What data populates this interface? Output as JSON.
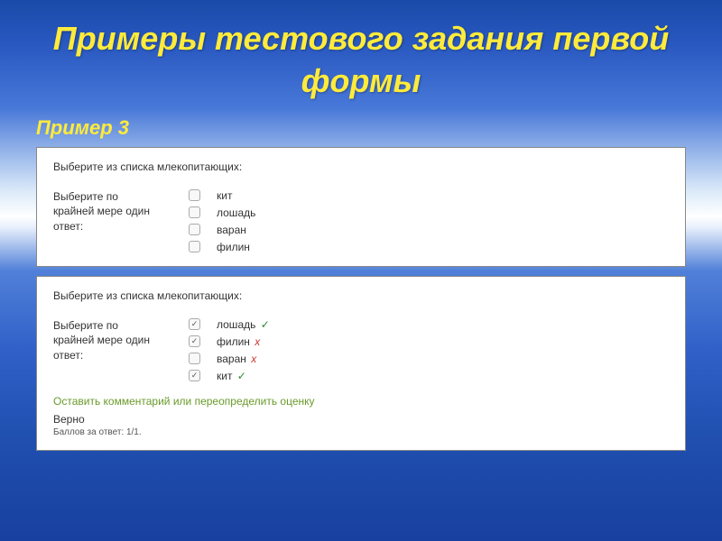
{
  "slide": {
    "title": "Примеры тестового задания первой формы",
    "example_label": "Пример 3"
  },
  "panel1": {
    "question": "Выберите из списка млекопитающих:",
    "instruction": "Выберите по крайней мере один ответ:",
    "options": [
      {
        "label": "кит",
        "checked": false
      },
      {
        "label": "лошадь",
        "checked": false
      },
      {
        "label": "варан",
        "checked": false
      },
      {
        "label": "филин",
        "checked": false
      }
    ]
  },
  "panel2": {
    "question": "Выберите из списка млекопитающих:",
    "instruction": "Выберите по крайней мере один ответ:",
    "options": [
      {
        "label": "лошадь",
        "checked": true,
        "mark": "✓",
        "mark_type": "correct"
      },
      {
        "label": "филин",
        "checked": true,
        "mark": "x",
        "mark_type": "wrong"
      },
      {
        "label": "варан",
        "checked": false,
        "mark": "x",
        "mark_type": "wrong"
      },
      {
        "label": "кит",
        "checked": true,
        "mark": "✓",
        "mark_type": "correct"
      }
    ],
    "comment_link": "Оставить комментарий или переопределить оценку",
    "verdict": "Верно",
    "score": "Баллов за ответ: 1/1."
  }
}
